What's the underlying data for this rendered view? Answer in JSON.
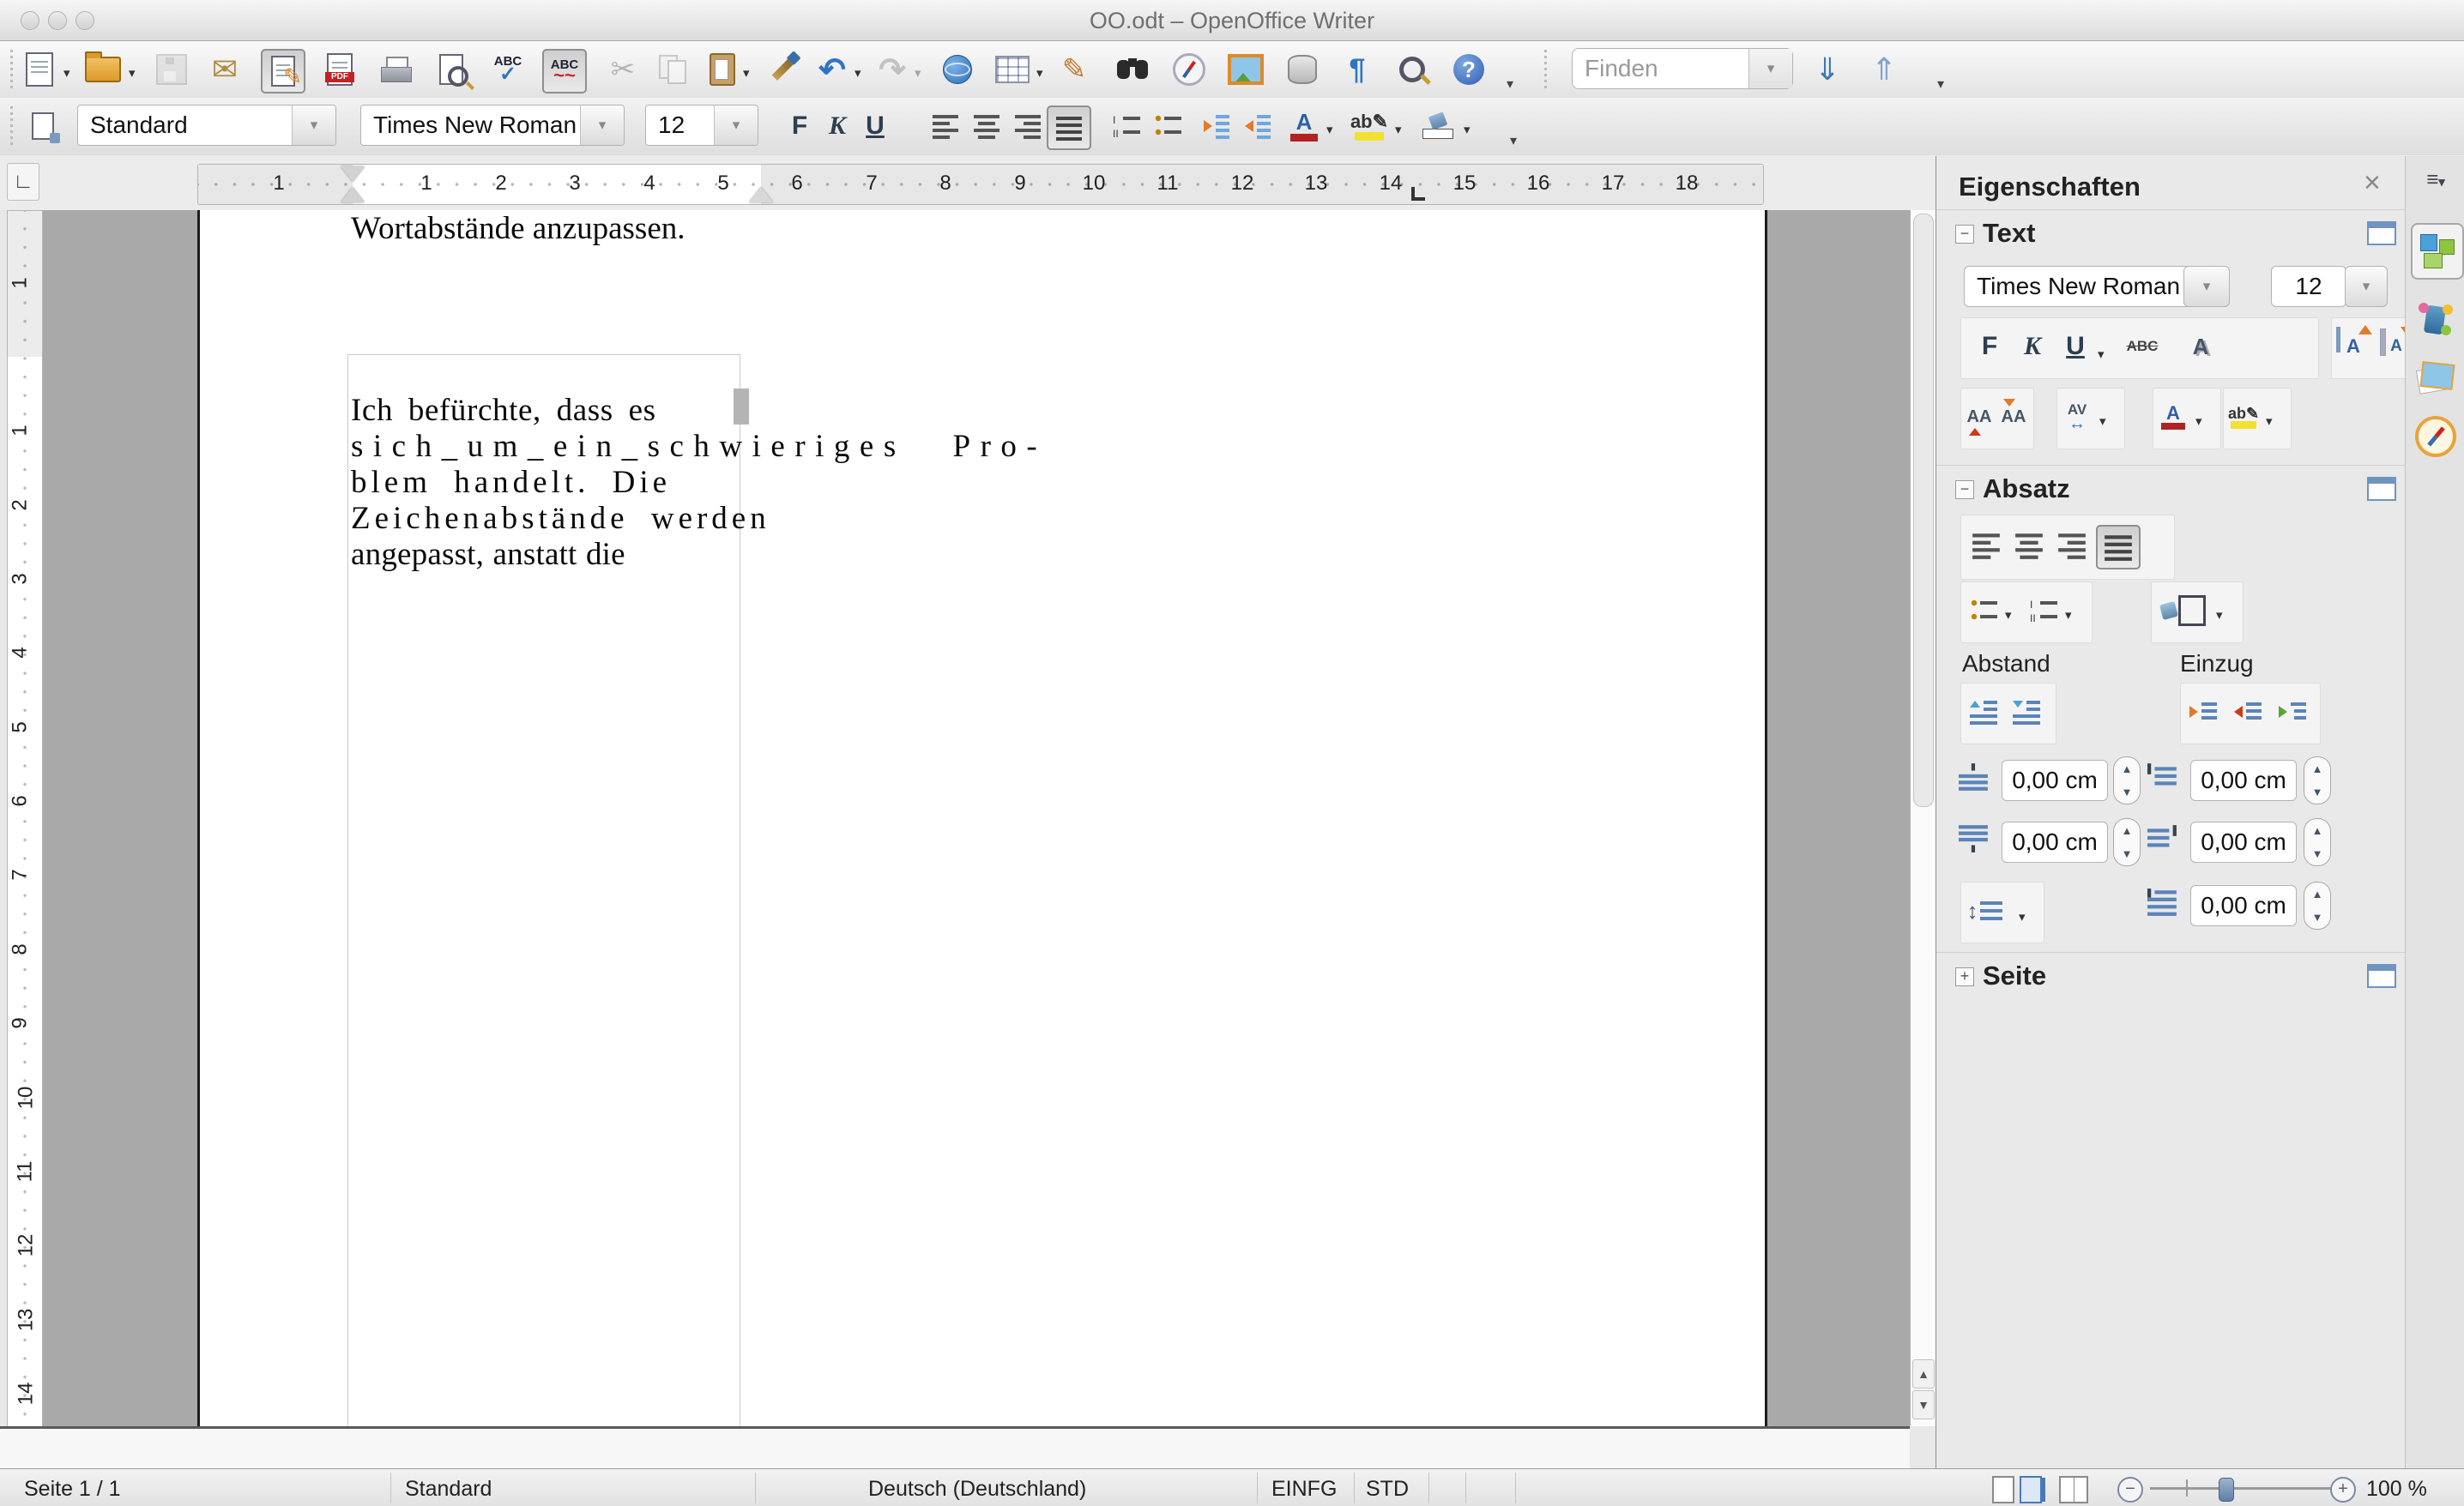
{
  "window": {
    "title": "OO.odt – OpenOffice Writer"
  },
  "find": {
    "placeholder": "Finden"
  },
  "formatting": {
    "style": "Standard",
    "font": "Times New Roman",
    "size": "12"
  },
  "icons": {
    "bold": "F",
    "italic": "K",
    "underline": "U",
    "abc": "ABC",
    "ab": "ab",
    "a": "A",
    "av": "AV",
    "aa": "AA",
    "pdf": "PDF",
    "question": "?",
    "pilcrow": "¶",
    "tab_corner": "∟",
    "minus": "−",
    "plus": "+",
    "close": "×",
    "undo": "↶",
    "redo": "↷",
    "cut": "✂",
    "mail": "✉",
    "pencil": "✎",
    "down": "⇓",
    "up": "⇑",
    "updown": "↕",
    "larr": "◄",
    "rarr": "►"
  },
  "ruler_h": {
    "margin_number": "1",
    "numbers": [
      "1",
      "2",
      "3",
      "4",
      "5",
      "6",
      "7",
      "8",
      "9",
      "10",
      "11",
      "12",
      "13",
      "14",
      "15",
      "16",
      "17",
      "18"
    ]
  },
  "ruler_v": {
    "margin_number": "1",
    "numbers": [
      "1",
      "2",
      "3",
      "4",
      "5",
      "6",
      "7",
      "8",
      "9",
      "10",
      "11",
      "12",
      "13",
      "14"
    ]
  },
  "document": {
    "lines": [
      "Ich befürchte, dass es",
      "sich_um_ein_schwieriges Pro-",
      "blem handelt. Die",
      "Zeichenabstände werden",
      "angepasst, anstatt die",
      "Wortabstände anzupassen."
    ]
  },
  "sidebar": {
    "title": "Eigenschaften",
    "text_section": "Text",
    "paragraph_section": "Absatz",
    "page_section": "Seite",
    "font": "Times New Roman",
    "size": "12",
    "spacing_label": "Abstand",
    "indent_label": "Einzug",
    "fields": {
      "above": "0,00 cm",
      "below": "0,00 cm",
      "before": "0,00 cm",
      "after": "0,00 cm",
      "firstline": "0,00 cm"
    }
  },
  "statusbar": {
    "page": "Seite 1 / 1",
    "style": "Standard",
    "language": "Deutsch (Deutschland)",
    "insert_mode": "EINFG",
    "selection_mode": "STD",
    "zoom": "100 %"
  }
}
